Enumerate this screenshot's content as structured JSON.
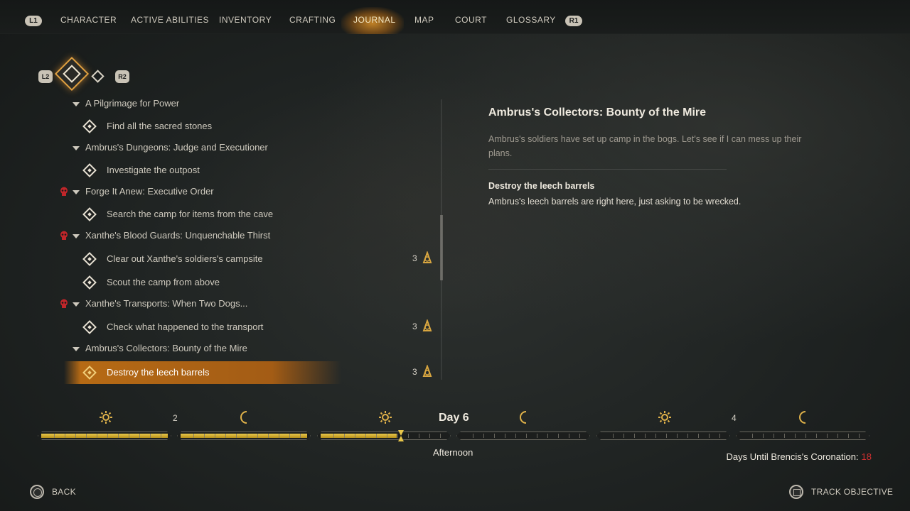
{
  "nav": {
    "left_button": "L1",
    "right_button": "R1",
    "tabs": [
      {
        "label": "CHARACTER"
      },
      {
        "label": "ACTIVE ABILITIES"
      },
      {
        "label": "INVENTORY"
      },
      {
        "label": "CRAFTING"
      },
      {
        "label": "JOURNAL",
        "active": true
      },
      {
        "label": "MAP"
      },
      {
        "label": "COURT"
      },
      {
        "label": "GLOSSARY"
      }
    ]
  },
  "filters": {
    "left_button": "L2",
    "right_button": "R2"
  },
  "quests": [
    {
      "type": "quest",
      "label": "A Pilgrimage for Power",
      "urgent": false
    },
    {
      "type": "task",
      "label": "Find all the sacred stones"
    },
    {
      "type": "quest",
      "label": "Ambrus's Dungeons: Judge and Executioner",
      "urgent": false
    },
    {
      "type": "task",
      "label": "Investigate the outpost"
    },
    {
      "type": "quest",
      "label": "Forge It Anew: Executive Order",
      "urgent": true
    },
    {
      "type": "task",
      "label": "Search the camp for items from the cave"
    },
    {
      "type": "quest",
      "label": "Xanthe's Blood Guards: Unquenchable Thirst",
      "urgent": true
    },
    {
      "type": "task",
      "label": "Clear out Xanthe's soldiers's campsite",
      "reward": "3"
    },
    {
      "type": "task",
      "label": "Scout the camp from above"
    },
    {
      "type": "quest",
      "label": "Xanthe's Transports: When Two Dogs...",
      "urgent": true
    },
    {
      "type": "task",
      "label": "Check what happened to the transport",
      "reward": "3"
    },
    {
      "type": "quest",
      "label": "Ambrus's Collectors: Bounty of the Mire",
      "urgent": false
    },
    {
      "type": "task",
      "label": "Destroy the leech barrels",
      "reward": "3",
      "selected": true
    }
  ],
  "detail": {
    "title": "Ambrus's Collectors: Bounty of the Mire",
    "description": "Ambrus's soldiers have set up camp in the bogs. Let's see if I can mess up their plans.",
    "objective_title": "Destroy the leech barrels",
    "objective_description": "Ambrus's leech barrels are right here, just asking to be wrecked."
  },
  "timeline": {
    "day_prev": "2",
    "day_current": "Day 6",
    "day_next": "4",
    "period": "Afternoon",
    "progress": [
      1,
      1,
      0.6,
      0,
      0,
      0
    ],
    "coronation_label": "Days Until Brencis's Coronation:",
    "coronation_days": "18",
    "accent": "#d23030",
    "bar_color": "#e8c64a"
  },
  "prompts": {
    "back": "BACK",
    "track": "TRACK OBJECTIVE"
  }
}
